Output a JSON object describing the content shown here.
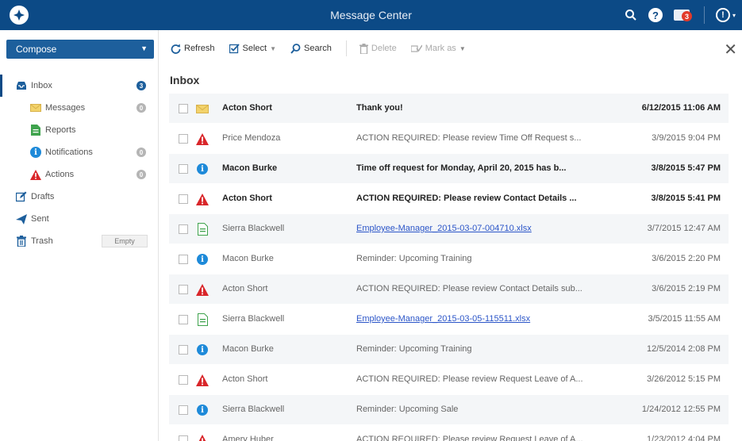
{
  "app": {
    "title": "Message Center"
  },
  "header": {
    "help_glyph": "?",
    "mail_badge_count": "3",
    "user_glyph": "!",
    "user_caret": "▾"
  },
  "sidebar": {
    "compose_label": "Compose",
    "compose_caret": "▼",
    "items": [
      {
        "label": "Inbox",
        "count": "3",
        "icon": "inbox-icon"
      },
      {
        "label": "Messages",
        "count": "0",
        "icon": "envelope-icon"
      },
      {
        "label": "Reports",
        "icon": "report-icon"
      },
      {
        "label": "Notifications",
        "count": "0",
        "icon": "info-icon"
      },
      {
        "label": "Actions",
        "count": "0",
        "icon": "warning-icon"
      },
      {
        "label": "Drafts",
        "icon": "pencil-icon"
      },
      {
        "label": "Sent",
        "icon": "send-icon"
      },
      {
        "label": "Trash",
        "icon": "trash-icon",
        "action": "Empty"
      }
    ]
  },
  "toolbar": {
    "refresh": "Refresh",
    "select": "Select",
    "search": "Search",
    "delete": "Delete",
    "mark_as": "Mark as",
    "caret": "▼",
    "close": "✕"
  },
  "inbox": {
    "title": "Inbox",
    "rows": [
      {
        "icon": "envelope-icon",
        "from": "Acton Short",
        "subject": "Thank you!",
        "date": "6/12/2015 11:06 AM",
        "unread": true
      },
      {
        "icon": "warning-icon",
        "from": "Price Mendoza",
        "subject": "ACTION REQUIRED: Please review Time Off Request s...",
        "date": "3/9/2015 9:04 PM",
        "unread": false
      },
      {
        "icon": "info-icon",
        "from": "Macon Burke",
        "subject": "Time off request for Monday, April 20, 2015 has b...",
        "date": "3/8/2015 5:47 PM",
        "unread": true
      },
      {
        "icon": "warning-icon",
        "from": "Acton Short",
        "subject": "ACTION REQUIRED: Please review Contact Details ...",
        "date": "3/8/2015 5:41 PM",
        "unread": true
      },
      {
        "icon": "report-icon",
        "from": "Sierra Blackwell",
        "subject": "Employee-Manager_2015-03-07-004710.xlsx",
        "date": "3/7/2015 12:47 AM",
        "unread": false,
        "link": true
      },
      {
        "icon": "info-icon",
        "from": "Macon Burke",
        "subject": "Reminder: Upcoming Training",
        "date": "3/6/2015 2:20 PM",
        "unread": false
      },
      {
        "icon": "warning-icon",
        "from": "Acton Short",
        "subject": "ACTION REQUIRED: Please review Contact Details sub...",
        "date": "3/6/2015 2:19 PM",
        "unread": false
      },
      {
        "icon": "report-icon",
        "from": "Sierra Blackwell",
        "subject": "Employee-Manager_2015-03-05-115511.xlsx",
        "date": "3/5/2015 11:55 AM",
        "unread": false,
        "link": true
      },
      {
        "icon": "info-icon",
        "from": "Macon Burke",
        "subject": "Reminder: Upcoming Training",
        "date": "12/5/2014 2:08 PM",
        "unread": false
      },
      {
        "icon": "warning-icon",
        "from": "Acton Short",
        "subject": "ACTION REQUIRED: Please review Request Leave of A...",
        "date": "3/26/2012 5:15 PM",
        "unread": false
      },
      {
        "icon": "info-icon",
        "from": "Sierra Blackwell",
        "subject": "Reminder: Upcoming Sale",
        "date": "1/24/2012 12:55 PM",
        "unread": false
      },
      {
        "icon": "warning-icon",
        "from": "Amery Huber",
        "subject": "ACTION REQUIRED: Please review Request Leave of A...",
        "date": "1/23/2012 4:04 PM",
        "unread": false
      }
    ]
  },
  "colors": {
    "header_bg": "#0c4a86",
    "accent": "#1d5f9c",
    "warning": "#d9262a",
    "info": "#1e8ad9",
    "report": "#3fa34d",
    "envelope": "#f3d36b",
    "link": "#2b55c8"
  },
  "icon_glyphs": {
    "info-icon": "i",
    "warning-icon": "!"
  }
}
